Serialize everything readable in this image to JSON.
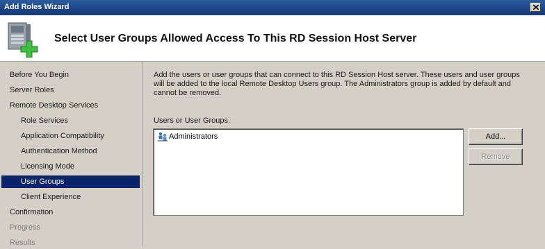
{
  "window": {
    "title": "Add Roles Wizard"
  },
  "header": {
    "page_title": "Select User Groups Allowed Access To This RD Session Host Server"
  },
  "nav": {
    "items": [
      {
        "label": "Before You Begin",
        "state": "normal"
      },
      {
        "label": "Server Roles",
        "state": "normal"
      },
      {
        "label": "Remote Desktop Services",
        "state": "normal"
      },
      {
        "label": "Role Services",
        "state": "sub"
      },
      {
        "label": "Application Compatibility",
        "state": "sub"
      },
      {
        "label": "Authentication Method",
        "state": "sub"
      },
      {
        "label": "Licensing Mode",
        "state": "sub"
      },
      {
        "label": "User Groups",
        "state": "active"
      },
      {
        "label": "Client Experience",
        "state": "sub"
      },
      {
        "label": "Confirmation",
        "state": "normal"
      },
      {
        "label": "Progress",
        "state": "disabled"
      },
      {
        "label": "Results",
        "state": "disabled"
      }
    ]
  },
  "content": {
    "description": "Add the users or user groups that can connect to this RD Session Host server. These users and user groups will be added to the local Remote Desktop Users group. The Administrators group is added by default and cannot be removed.",
    "list_label": "Users or User Groups:",
    "list_items": [
      "Administrators"
    ],
    "add_button": "Add...",
    "remove_button": "Remove"
  },
  "colors": {
    "titlebar": "#1d4585",
    "selection": "#0a246a",
    "face": "#d4d0c8"
  }
}
